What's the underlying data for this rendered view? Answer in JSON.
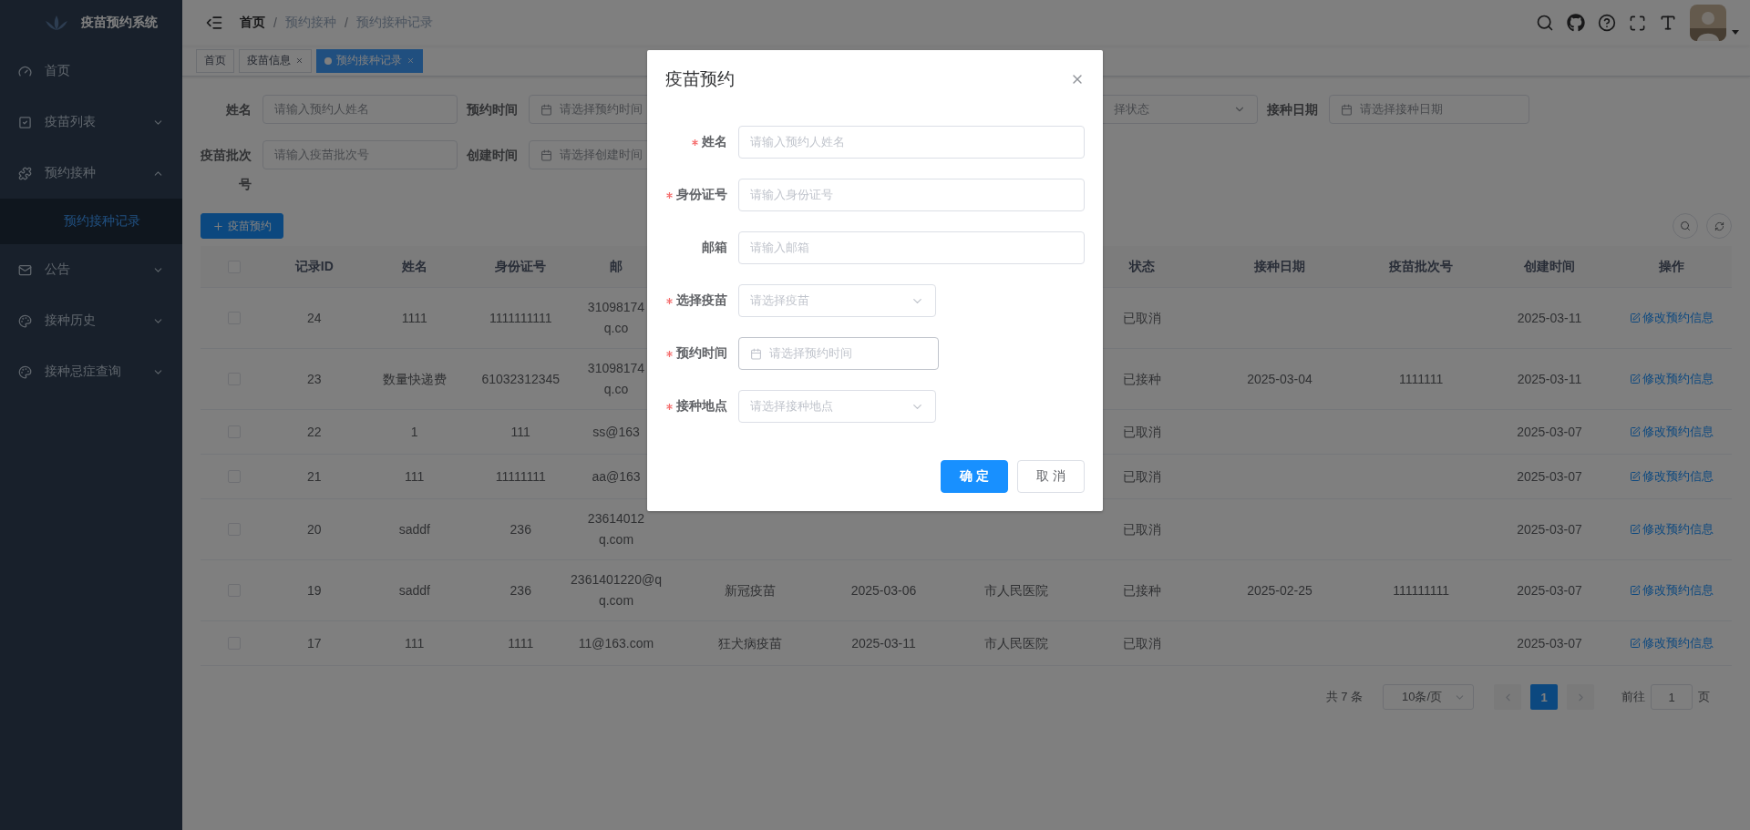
{
  "sidebar": {
    "title": "疫苗预约系统",
    "items": [
      {
        "label": "首页",
        "kind": "link",
        "selected": false
      },
      {
        "label": "疫苗列表",
        "kind": "submenu",
        "expanded": false,
        "selected": false
      },
      {
        "label": "预约接种",
        "kind": "submenu",
        "expanded": true,
        "selected": false,
        "children": [
          {
            "label": "预约接种记录",
            "selected": true
          }
        ]
      },
      {
        "label": "公告",
        "kind": "submenu",
        "expanded": false,
        "selected": false
      },
      {
        "label": "接种历史",
        "kind": "submenu",
        "expanded": false,
        "selected": false
      },
      {
        "label": "接种忌症查询",
        "kind": "submenu",
        "expanded": false,
        "selected": false
      }
    ]
  },
  "breadcrumb": [
    {
      "kind": "link",
      "label": "首页"
    },
    {
      "kind": "separator",
      "label": "/"
    },
    {
      "kind": "text",
      "label": "预约接种"
    },
    {
      "kind": "separator",
      "label": "/"
    },
    {
      "kind": "text",
      "label": "预约接种记录"
    }
  ],
  "tags": [
    {
      "label": "首页",
      "closable": false,
      "selected": false
    },
    {
      "label": "疫苗信息",
      "closable": true,
      "selected": false
    },
    {
      "label": "预约接种记录",
      "closable": true,
      "selected": true
    }
  ],
  "filters": [
    [
      {
        "label": "姓名",
        "kind": "input",
        "placeholder": "请输入预约人姓名"
      },
      {
        "label": "预约时间",
        "kind": "date",
        "placeholder": "请选择预约时间"
      },
      {
        "kind": "select",
        "placeholder": "择状态"
      },
      {
        "label": "接种日期",
        "kind": "date",
        "placeholder": "请选择接种日期"
      }
    ],
    [
      {
        "label": "疫苗批次号",
        "kind": "input",
        "placeholder": "请输入疫苗批次号"
      },
      {
        "label": "创建时间",
        "kind": "date",
        "placeholder": "请选择创建时间"
      }
    ]
  ],
  "add_button": "疫苗预约",
  "table": {
    "all_checked": false,
    "columns": {
      "id": "记录ID",
      "name": "姓名",
      "id_number": "身份证号",
      "email": "邮",
      "status": "状态",
      "vaccination_date": "接种日期",
      "batch_no": "疫苗批次号",
      "created": "创建时间",
      "action": "操作"
    },
    "rows": [
      {
        "checked": false,
        "id": "24",
        "name": "1111",
        "id_number": "1111111111",
        "email": [
          "31098174",
          "q.co"
        ],
        "status": "已取消",
        "created": "2025-03-11",
        "action": "修改预约信息"
      },
      {
        "checked": false,
        "id": "23",
        "name": "数量快递费",
        "id_number": "61032312345",
        "email": [
          "31098174",
          "q.co"
        ],
        "status": "已接种",
        "vaccination_date": "2025-03-04",
        "batch_no": "1111111",
        "created": "2025-03-11",
        "action": "修改预约信息"
      },
      {
        "checked": false,
        "id": "22",
        "name": "1",
        "id_number": "111",
        "email": [
          "ss@163"
        ],
        "status": "已取消",
        "created": "2025-03-07",
        "action": "修改预约信息"
      },
      {
        "checked": false,
        "id": "21",
        "name": "111",
        "id_number": "11111111",
        "email": [
          "aa@163"
        ],
        "status": "已取消",
        "created": "2025-03-07",
        "action": "修改预约信息"
      },
      {
        "checked": false,
        "id": "20",
        "name": "saddf",
        "id_number": "236",
        "email": [
          "23614012",
          "q.com"
        ],
        "status": "已取消",
        "created": "2025-03-07",
        "action": "修改预约信息"
      },
      {
        "checked": false,
        "id": "19",
        "name": "saddf",
        "id_number": "236",
        "email": [
          "2361401220@q",
          "q.com"
        ],
        "vaccine": "新冠疫苗",
        "appointment": "2025-03-06",
        "site": "市人民医院",
        "status": "已接种",
        "vaccination_date": "2025-02-25",
        "batch_no": "111111111",
        "created": "2025-03-07",
        "action": "修改预约信息"
      },
      {
        "checked": false,
        "id": "17",
        "name": "111",
        "id_number": "1111",
        "email": [
          "11@163.com"
        ],
        "vaccine": "狂犬病疫苗",
        "appointment": "2025-03-11",
        "site": "市人民医院",
        "status": "已取消",
        "created": "2025-03-07",
        "action": "修改预约信息"
      }
    ]
  },
  "pagination": {
    "total": "共 7 条",
    "page_size": "10条/页",
    "pages": [
      {
        "label": "1",
        "selected": true
      }
    ],
    "jump_label": "前往",
    "jump_value": "1",
    "jump_suffix": "页"
  },
  "modal": {
    "title": "疫苗预约",
    "fields": [
      {
        "label": "姓名",
        "required": true,
        "kind": "input",
        "placeholder": "请输入预约人姓名",
        "focused": false
      },
      {
        "label": "身份证号",
        "required": true,
        "kind": "input",
        "placeholder": "请输入身份证号",
        "focused": false
      },
      {
        "label": "邮箱",
        "required": false,
        "kind": "input",
        "placeholder": "请输入邮箱",
        "focused": false
      },
      {
        "label": "选择疫苗",
        "required": true,
        "kind": "select",
        "placeholder": "请选择疫苗",
        "focused": false
      },
      {
        "label": "预约时间",
        "required": true,
        "kind": "date",
        "placeholder": "请选择预约时间",
        "focused": true
      },
      {
        "label": "接种地点",
        "required": true,
        "kind": "select",
        "placeholder": "请选择接种地点",
        "focused": false
      }
    ],
    "buttons": [
      {
        "label": "确 定",
        "kind": "primary"
      },
      {
        "label": "取 消",
        "kind": "default"
      }
    ]
  }
}
